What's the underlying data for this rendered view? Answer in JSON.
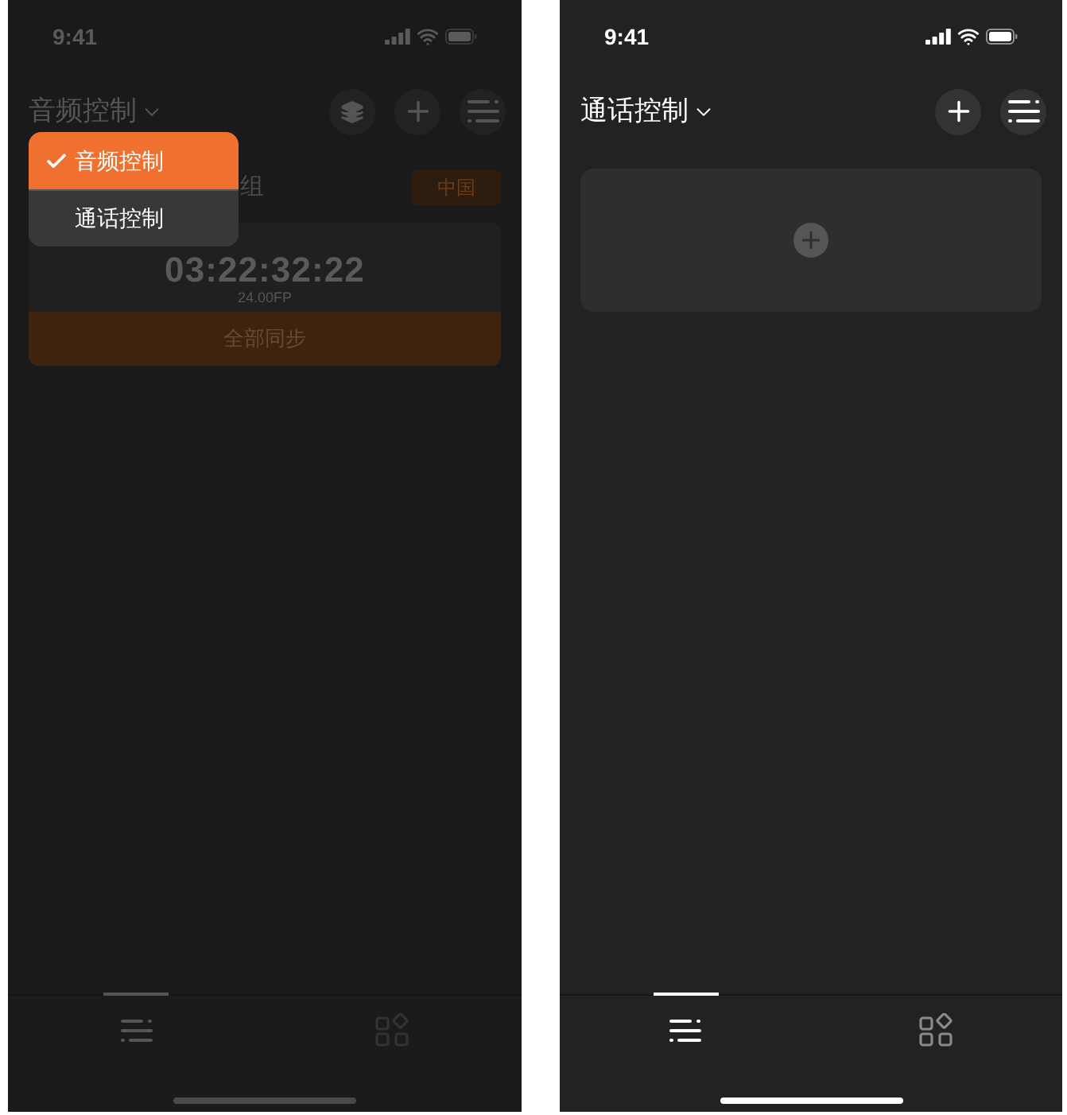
{
  "screens": [
    {
      "status_time": "9:41",
      "dimmed": true,
      "title": "音频控制",
      "header_buttons": [
        {
          "kind": "layers"
        },
        {
          "kind": "add"
        },
        {
          "kind": "list"
        }
      ],
      "group_label": "组",
      "region_tag": "中国",
      "timecode": {
        "time": "03:22:32:22",
        "rate": "24.00FP"
      },
      "sync_button": "全部同步",
      "dropdown": {
        "options": [
          {
            "label": "音频控制",
            "selected": true
          },
          {
            "label": "通话控制",
            "selected": false
          }
        ]
      },
      "tabs": [
        {
          "kind": "list",
          "selected": true
        },
        {
          "kind": "grid",
          "selected": false
        }
      ]
    },
    {
      "status_time": "9:41",
      "dimmed": false,
      "title": "通话控制",
      "header_buttons": [
        {
          "kind": "add"
        },
        {
          "kind": "list"
        }
      ],
      "cards": [
        {
          "kind": "add"
        }
      ],
      "tabs": [
        {
          "kind": "list",
          "selected": true
        },
        {
          "kind": "grid",
          "selected": false
        }
      ]
    }
  ]
}
